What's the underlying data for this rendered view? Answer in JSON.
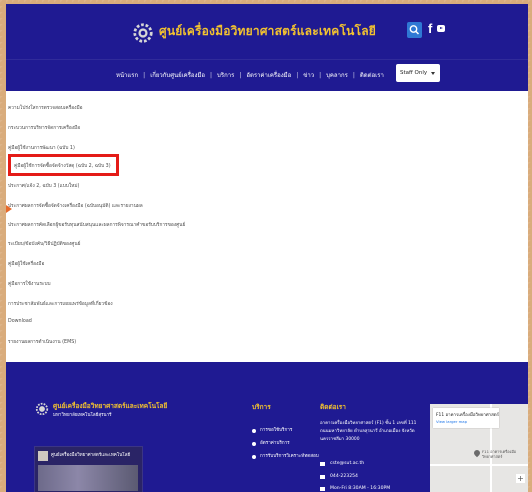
{
  "header": {
    "site_name": "ศูนย์เครื่องมือวิทยาศาสตร์และเทคโนโลยี",
    "icons": [
      "gear-logo-icon",
      "search-icon",
      "facebook-icon",
      "youtube-icon"
    ]
  },
  "nav": {
    "items": [
      "หน้าแรก",
      "เกี่ยวกับศูนย์เครื่องมือ",
      "บริการ",
      "อัตราค่าเครื่องมือ",
      "ข่าว",
      "บุคลากร",
      "ติดต่อเรา"
    ],
    "staff_select": "Staff Only"
  },
  "content": {
    "items": [
      "ความโปร่งใสการตรวจสอบเครื่องมือ",
      "กระบวนการบริหารจัดการเครื่องมือ",
      "คู่มือผู้ใช้งานการพัฒนา (ฉบับ 1)",
      "คู่มือผู้ใช้การจัดซื้อจัดจ้างวัสดุ (ฉบับ 2, ฉบับ 3)",
      "ประกาศ/แจ้ง 2, ฉบับ 3 (แบบใหม่)",
      "ประกาศผลการจัดซื้อจัดจ้างเครื่องมือ (ฉบับอนุมัติ) และรายงานผล",
      "ประกาศผลการคัดเลือกผู้ขอรับทุนสนับสนุนและผลการพิจารณาคำขอรับบริการของศูนย์",
      "ระเบียบ/ข้อบังคับ/วิธีปฏิบัติของศูนย์",
      "คู่มือผู้ใช้เครื่องมือ",
      "คู่มือการใช้งานระบบ",
      "การประชาสัมพันธ์และการเผยแพร่ข้อมูลที่เกี่ยวข้อง",
      "Download",
      "รายงานผลการดำเนินงาน (EMS)"
    ]
  },
  "footer": {
    "org_name": "ศูนย์เครื่องมือวิทยาศาสตร์และเทคโนโลยี",
    "org_sub": "มหาวิทยาลัยเทคโนโลยีสุรนารี",
    "fb_card_title": "ศูนย์เครื่องมือวิทยาศาสตร์และเทคโนโลยี",
    "services_title": "บริการ",
    "services": [
      "การขอใช้บริการ",
      "อัตราค่าบริการ",
      "การรับบริการวิเคราะห์ทดสอบ"
    ],
    "contact_title": "ติดต่อเรา",
    "address": "อาคารเครื่องมือวิทยาศาสตร์ (F1) ชั้น 1 เลขที่ 111 ถนนมหาวิทยาลัย ตำบลสุรนารี อำเภอเมือง จังหวัดนครราชสีมา 30000",
    "email": "cste@sut.ac.th",
    "phone": "044-223254",
    "hours": "Mon-Fri 8:30AM - 16:30PM",
    "map_title": "F11 อาคารเครื่องมือวิทยาศาสตร์",
    "map_link": "View larger map",
    "map_place": "F11 อาคารเครื่องมือวิทยาศาสตร์"
  },
  "colors": {
    "brand_navy": "#1f1a92",
    "brand_gold": "#f2c230",
    "highlight_red": "#e41b17"
  }
}
